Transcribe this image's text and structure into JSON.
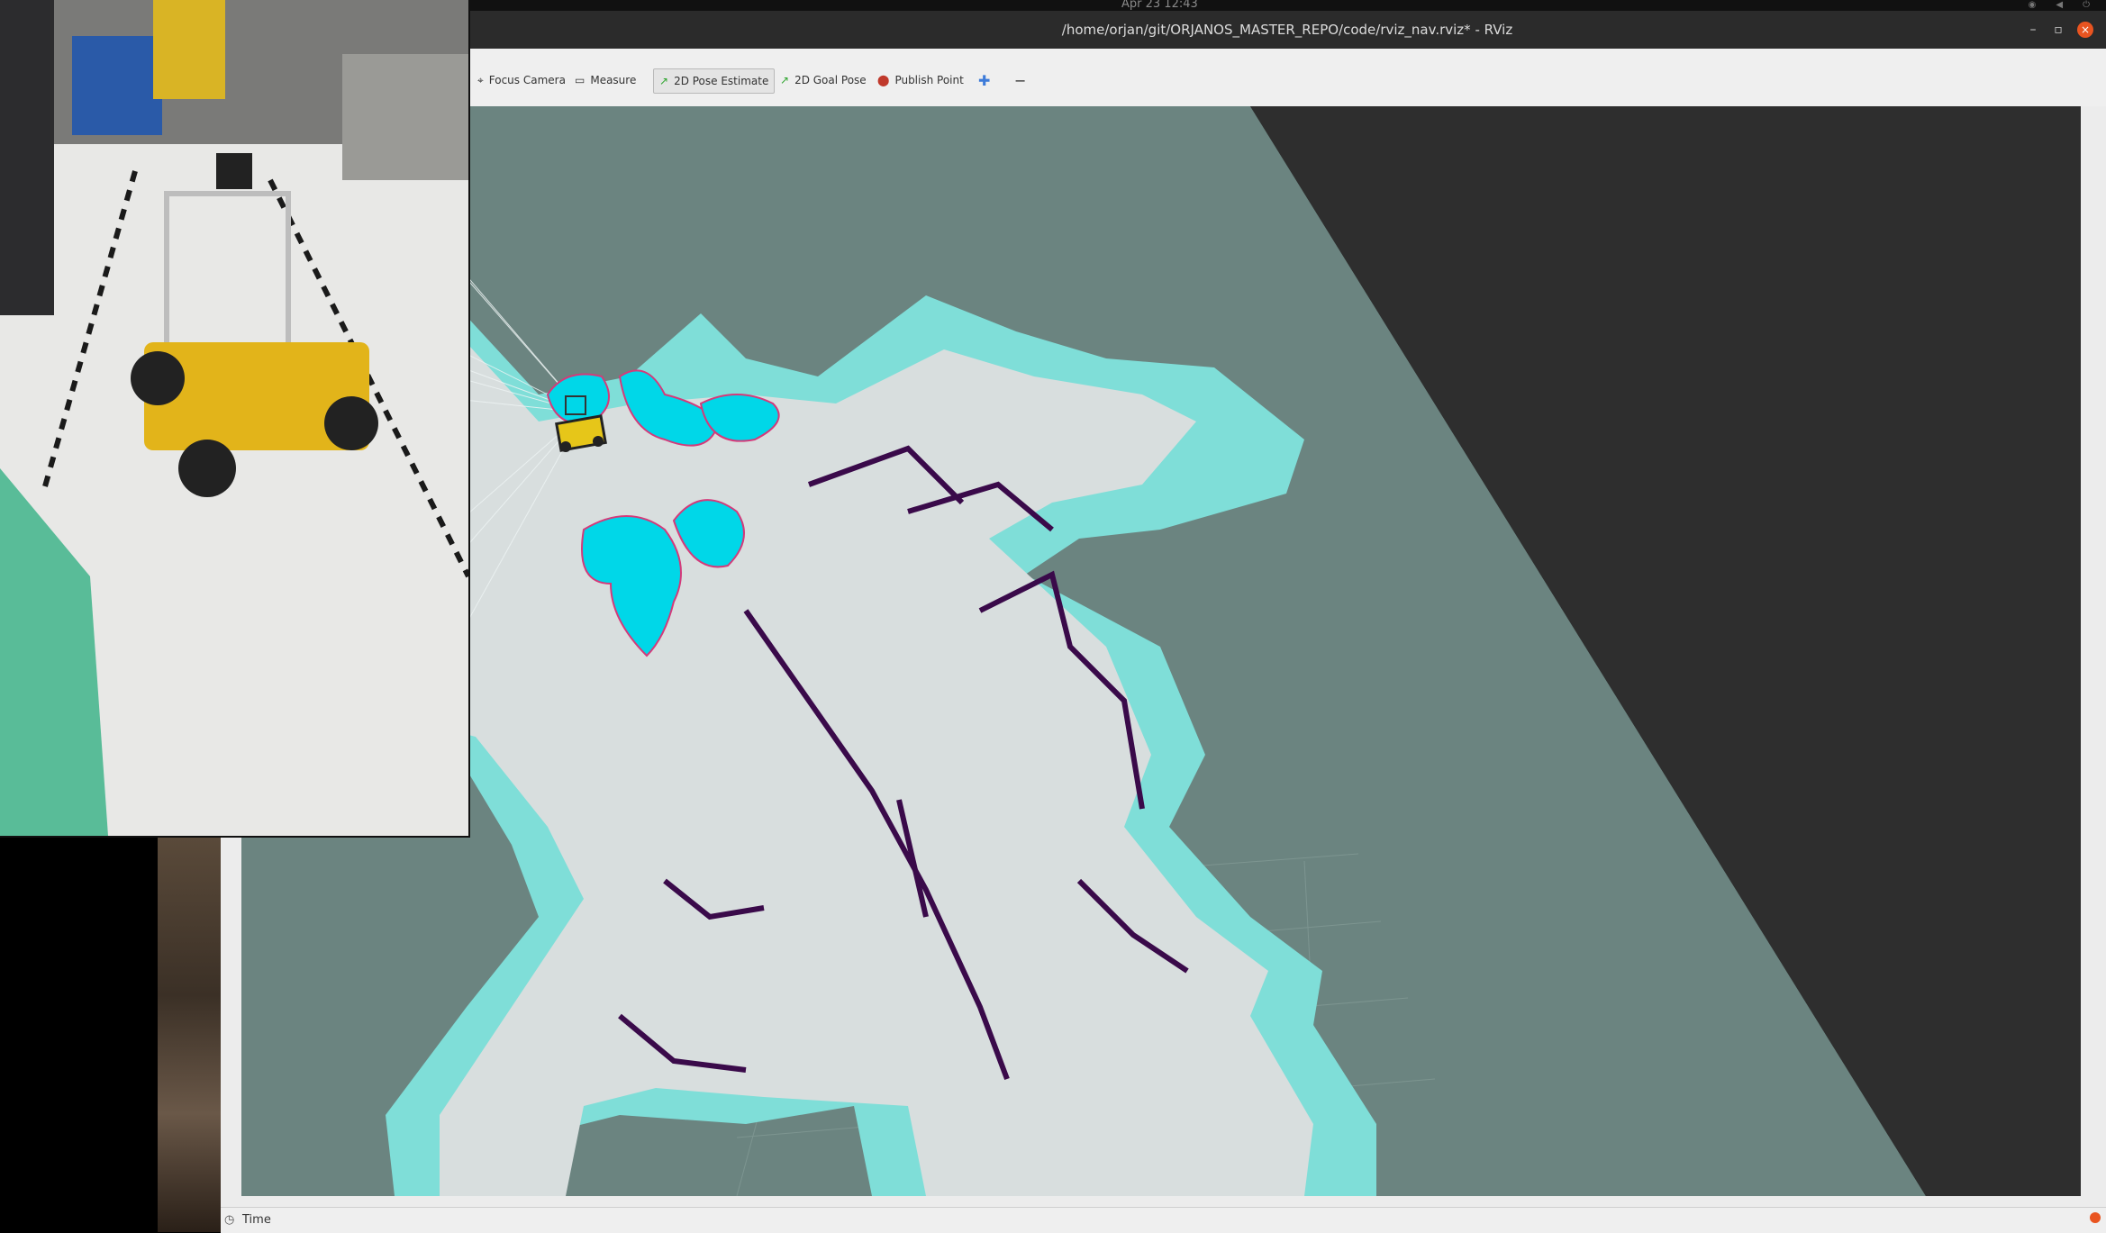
{
  "system": {
    "clock": "Apr 23  12:43"
  },
  "window": {
    "title": "/home/orjan/git/ORJANOS_MASTER_REPO/code/rviz_nav.rviz* - RViz",
    "minimize_label": "–",
    "maximize_label": "▫",
    "close_label": "×"
  },
  "toolbar": {
    "tools": [
      {
        "label": "Focus Camera",
        "icon": "crosshair-icon",
        "active": false
      },
      {
        "label": "Measure",
        "icon": "ruler-icon",
        "active": false
      },
      {
        "label": "2D Pose Estimate",
        "icon": "green-arrow-icon",
        "active": true
      },
      {
        "label": "2D Goal Pose",
        "icon": "green-arrow-icon",
        "active": false
      },
      {
        "label": "Publish Point",
        "icon": "map-pin-icon",
        "active": false
      }
    ],
    "add_icon": "plus-icon",
    "remove_icon": "minus-icon"
  },
  "statusbar": {
    "time_label": "Time"
  },
  "colors": {
    "map_free": "#d8dede",
    "map_unknown": "#6b8480",
    "costmap_inflation": "#7fded8",
    "costmap_lethal": "#00d7e8",
    "obstacle": "#3a0a4a",
    "robot_body": "#e6c619",
    "background": "#2e2e2e"
  }
}
